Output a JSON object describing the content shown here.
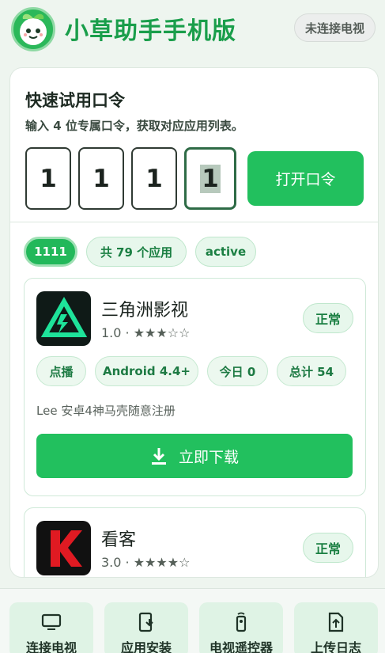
{
  "header": {
    "title": "小草助手手机版",
    "tv_status": "未连接电视",
    "logo_icon": "grass-mascot-icon"
  },
  "quick_trial": {
    "title": "快速试用口令",
    "subtitle": "输入 4 位专属口令，获取对应应用列表。",
    "digits": [
      "1",
      "1",
      "1",
      "1"
    ],
    "open_button": "打开口令"
  },
  "chips": {
    "code": "1111",
    "count": "共 79 个应用",
    "status": "active"
  },
  "apps": [
    {
      "name": "三角洲影视",
      "rating_text": "1.0 · ★★★☆☆",
      "status": "正常",
      "tags": [
        "点播",
        "Android 4.4+",
        "今日 0",
        "总计 54"
      ],
      "description": "Lee 安卓4神马壳随意注册",
      "download_label": "立即下载",
      "icon": "triangle-app-icon"
    },
    {
      "name": "看客",
      "rating_text": "3.0 · ★★★★☆",
      "status": "正常",
      "icon": "k-app-icon"
    }
  ],
  "bottom_nav": [
    {
      "label": "连接电视",
      "icon": "tv-icon"
    },
    {
      "label": "应用安装",
      "icon": "phone-install-icon"
    },
    {
      "label": "电视遥控器",
      "icon": "remote-icon"
    },
    {
      "label": "上传日志",
      "icon": "upload-file-icon"
    }
  ],
  "colors": {
    "accent": "#22c05e",
    "title_green": "#1a9e4b",
    "background": "#eef5ef"
  }
}
